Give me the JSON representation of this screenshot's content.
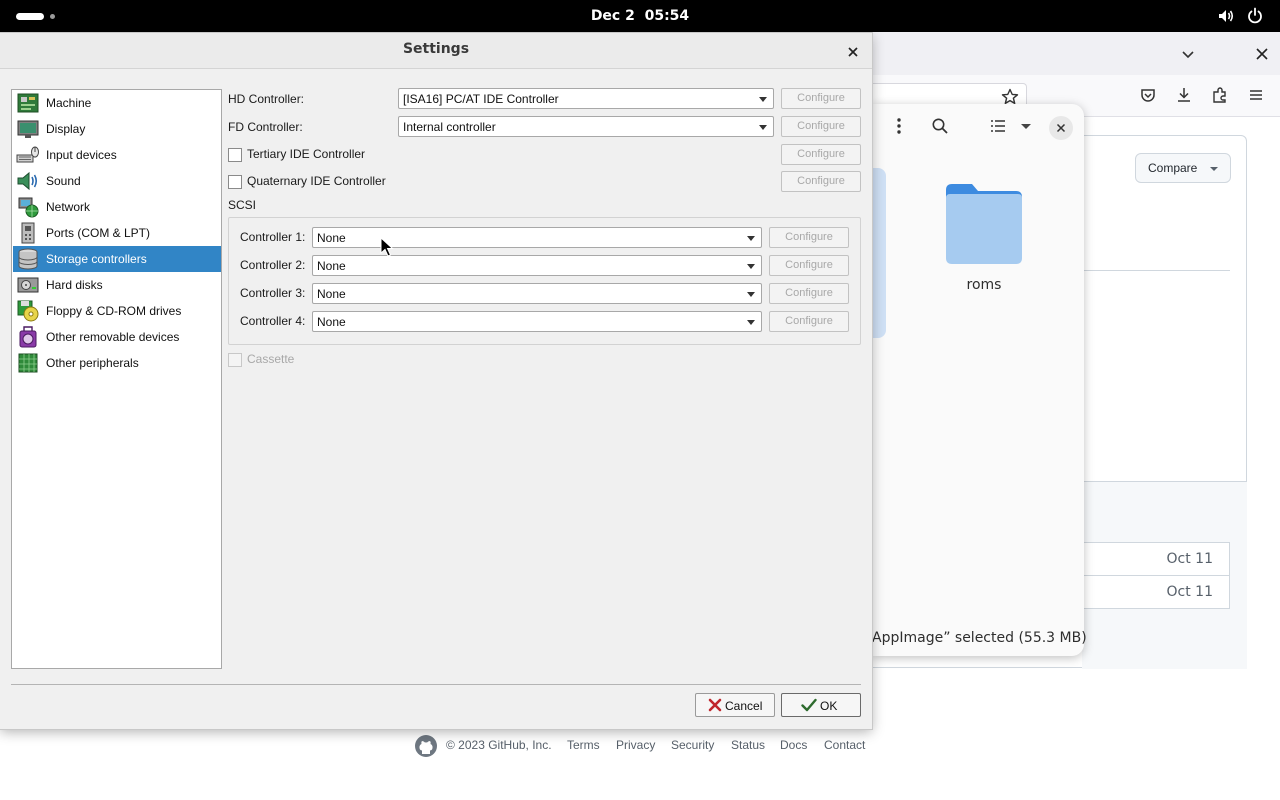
{
  "topbar": {
    "date": "Dec 2",
    "time": "05:54"
  },
  "dialog": {
    "title": "Settings",
    "nav": [
      {
        "label": "Machine",
        "icon": "machine-icon"
      },
      {
        "label": "Display",
        "icon": "display-icon"
      },
      {
        "label": "Input devices",
        "icon": "input-devices-icon"
      },
      {
        "label": "Sound",
        "icon": "sound-icon"
      },
      {
        "label": "Network",
        "icon": "network-icon"
      },
      {
        "label": "Ports (COM & LPT)",
        "icon": "ports-icon"
      },
      {
        "label": "Storage controllers",
        "icon": "storage-icon",
        "selected": true
      },
      {
        "label": "Hard disks",
        "icon": "hard-disk-icon"
      },
      {
        "label": "Floppy & CD-ROM drives",
        "icon": "floppy-cdrom-icon"
      },
      {
        "label": "Other removable devices",
        "icon": "removable-devices-icon"
      },
      {
        "label": "Other peripherals",
        "icon": "peripherals-icon"
      }
    ],
    "hd_controller": {
      "label": "HD Controller:",
      "value": "[ISA16] PC/AT IDE Controller"
    },
    "fd_controller": {
      "label": "FD Controller:",
      "value": "Internal controller"
    },
    "tertiary_ide": {
      "label": "Tertiary IDE Controller",
      "checked": false
    },
    "quaternary_ide": {
      "label": "Quaternary IDE Controller",
      "checked": false
    },
    "scsi": {
      "label": "SCSI",
      "controllers": [
        {
          "label": "Controller 1:",
          "value": "None"
        },
        {
          "label": "Controller 2:",
          "value": "None"
        },
        {
          "label": "Controller 3:",
          "value": "None"
        },
        {
          "label": "Controller 4:",
          "value": "None"
        }
      ]
    },
    "cassette": {
      "label": "Cassette",
      "checked": false,
      "enabled": false
    },
    "configure_label": "Configure",
    "cancel_label": "Cancel",
    "ok_label": "OK"
  },
  "background": {
    "compare_label": "Compare",
    "folder_label": "roms",
    "selection_status": "AppImage” selected  (55.3 MB)",
    "rows": [
      {
        "date": "Oct 11"
      },
      {
        "date": "Oct 11"
      }
    ],
    "footer": {
      "copyright": "© 2023 GitHub, Inc.",
      "links": [
        "Terms",
        "Privacy",
        "Security",
        "Status",
        "Docs",
        "Contact"
      ]
    }
  },
  "colors": {
    "selection": "#3185c6",
    "topbar": "#000000",
    "folder": "#5aa0e6"
  }
}
